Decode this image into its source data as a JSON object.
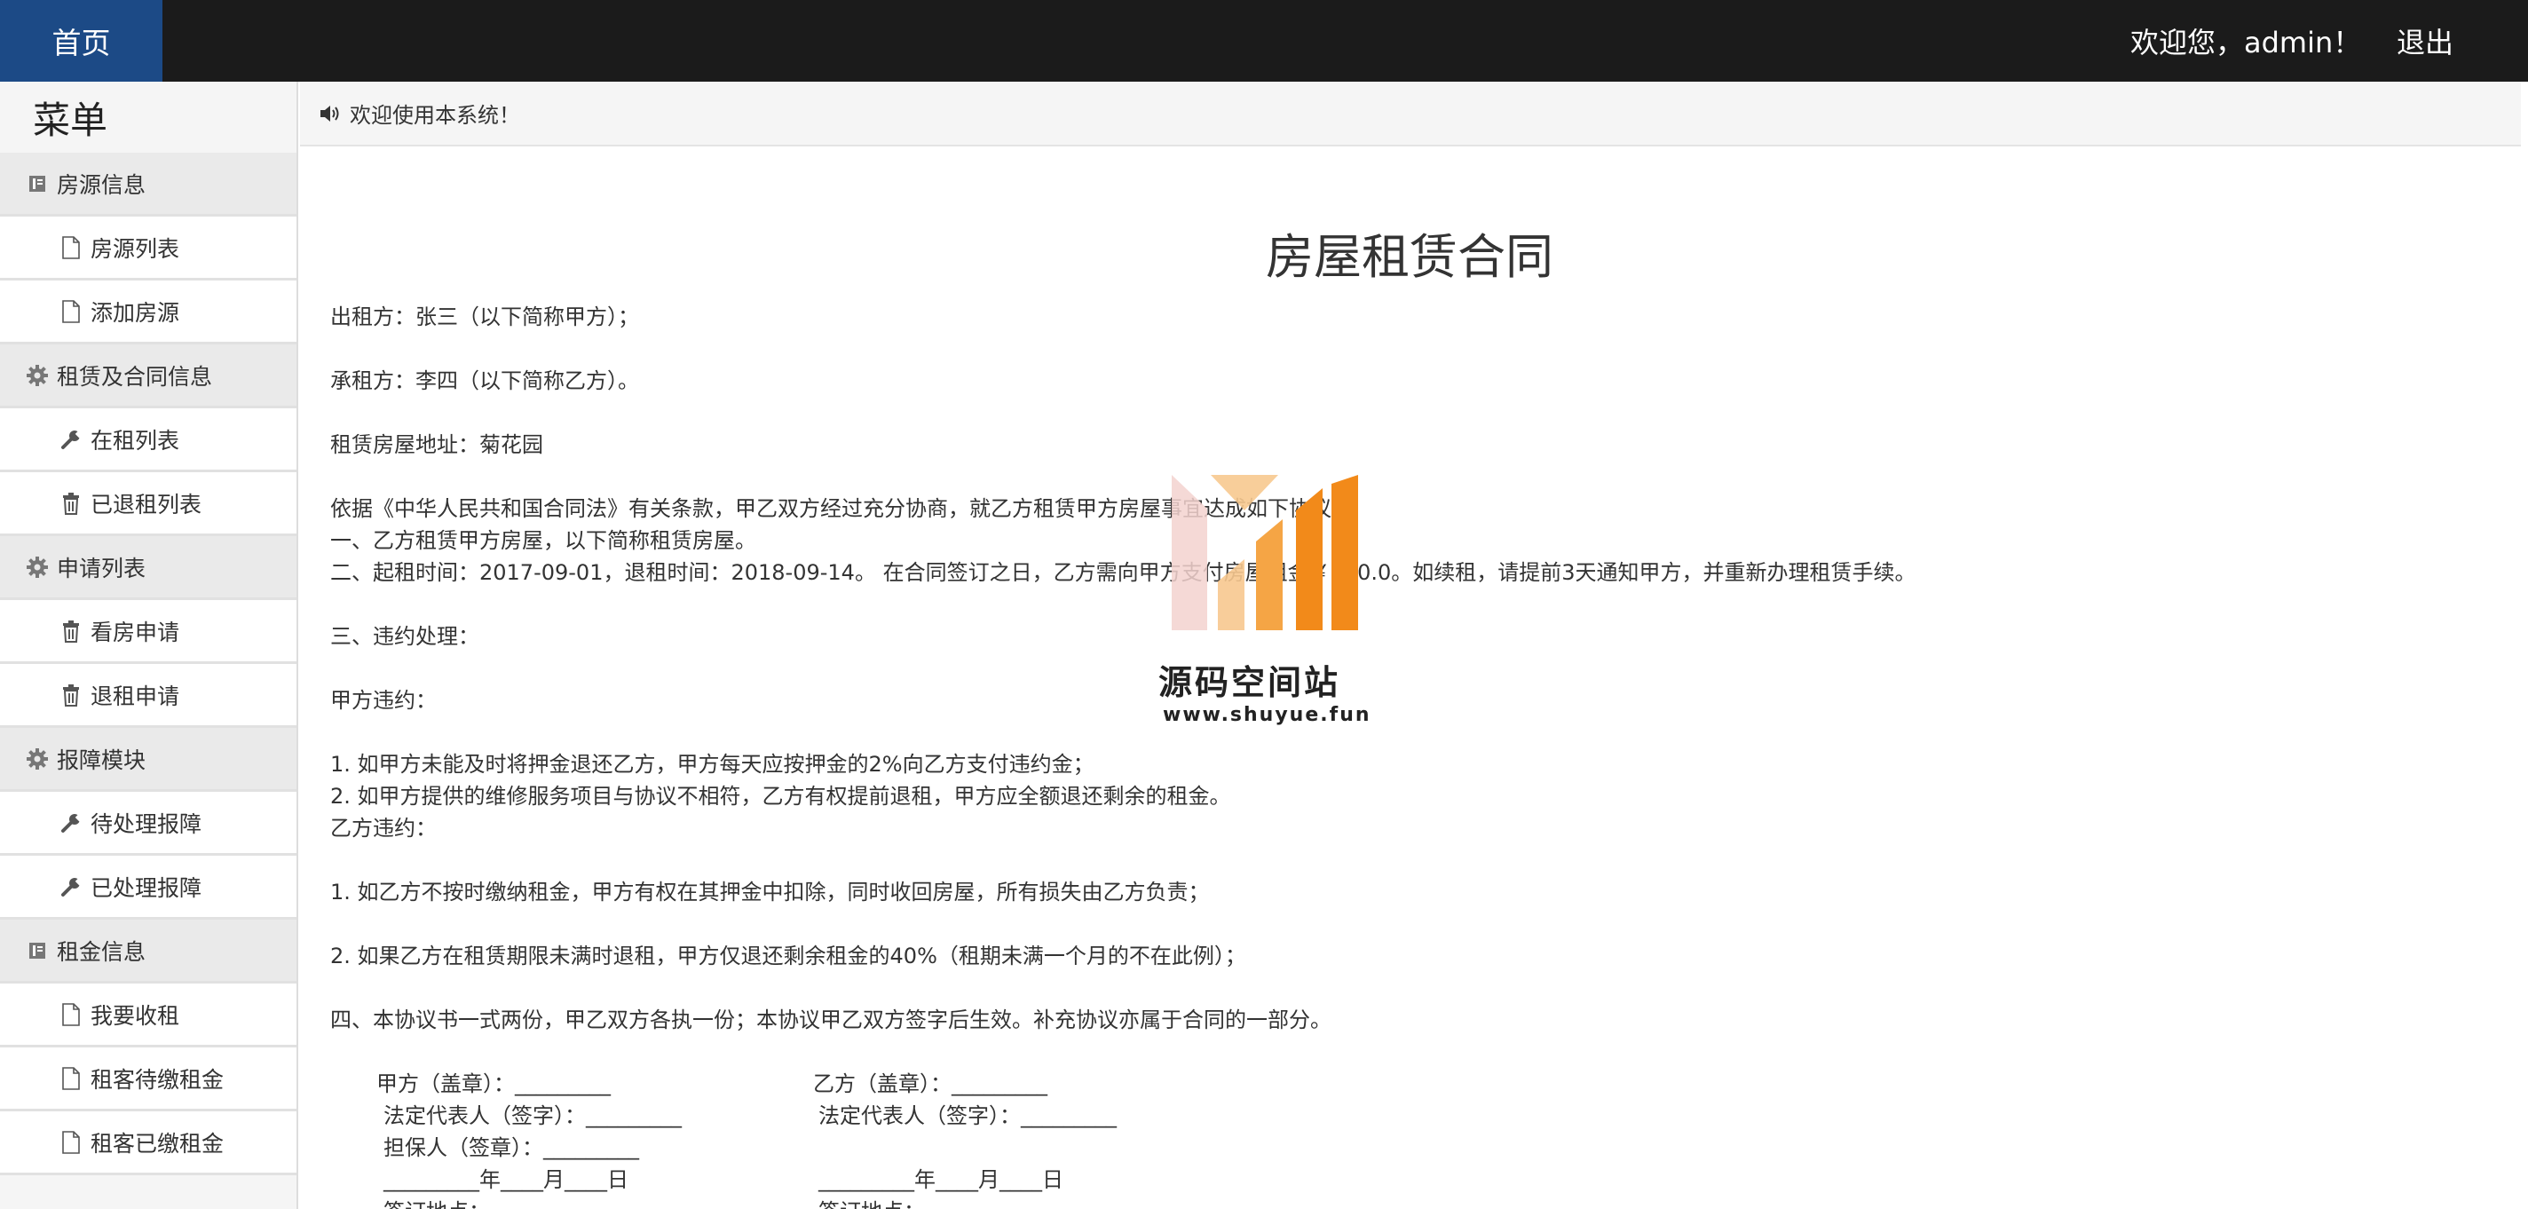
{
  "topbar": {
    "home": "首页",
    "welcome": "欢迎您，admin！",
    "logout": "退出",
    "bg_color": "#1b1b1b",
    "home_color": "#1c4a86"
  },
  "sidebar": {
    "title": "菜单",
    "sections": [
      {
        "label": "房源信息",
        "icon": "book-icon",
        "items": [
          {
            "label": "房源列表",
            "icon": "file-icon"
          },
          {
            "label": "添加房源",
            "icon": "file-icon"
          }
        ]
      },
      {
        "label": "租赁及合同信息",
        "icon": "gear-icon",
        "items": [
          {
            "label": "在租列表",
            "icon": "wrench-icon"
          },
          {
            "label": "已退租列表",
            "icon": "trash-icon"
          }
        ]
      },
      {
        "label": "申请列表",
        "icon": "gear-icon",
        "items": [
          {
            "label": "看房申请",
            "icon": "trash-icon"
          },
          {
            "label": "退租申请",
            "icon": "trash-icon"
          }
        ]
      },
      {
        "label": "报障模块",
        "icon": "gear-icon",
        "items": [
          {
            "label": "待处理报障",
            "icon": "wrench-icon"
          },
          {
            "label": "已处理报障",
            "icon": "wrench-icon"
          }
        ]
      },
      {
        "label": "租金信息",
        "icon": "book-icon",
        "items": [
          {
            "label": "我要收租",
            "icon": "file-icon"
          },
          {
            "label": "租客待缴租金",
            "icon": "file-icon"
          },
          {
            "label": "租客已缴租金",
            "icon": "file-icon"
          }
        ]
      }
    ]
  },
  "notice": {
    "icon": "speaker-icon",
    "text": "欢迎使用本系统！"
  },
  "contract": {
    "title": "房屋租赁合同",
    "lessor": "出租方：张三（以下简称甲方）；",
    "lessee": "承租方：李四（以下简称乙方）。",
    "address": "租赁房屋地址：菊花园",
    "basis": "依据《中华人民共和国合同法》有关条款，甲乙双方经过充分协商，就乙方租赁甲方房屋事宜达成如下协议：",
    "clause1": "一、乙方租赁甲方房屋，以下简称租赁房屋。",
    "clause2": "二、起租时间：2017-09-01，退租时间：2018-09-14。 在合同签订之日，乙方需向甲方支付房屋租金￥900.0。如续租，请提前3天通知甲方，并重新办理租赁手续。",
    "clause3": "三、违约处理：",
    "partyA_breach": "甲方违约：",
    "a1": "1.  如甲方未能及时将押金退还乙方，甲方每天应按押金的2%向乙方支付违约金；",
    "a2": "2.  如甲方提供的维修服务项目与协议不相符，乙方有权提前退租，甲方应全额退还剩余的租金。",
    "partyB_breach": "乙方违约：",
    "b1": "1.  如乙方不按时缴纳租金，甲方有权在其押金中扣除，同时收回房屋，所有损失由乙方负责；",
    "b2": "2.  如果乙方在租赁期限未满时退租，甲方仅退还剩余租金的40%（租期未满一个月的不在此例）；",
    "clause4": "四、本协议书一式两份，甲乙双方各执一份；本协议甲乙双方签字后生效。补充协议亦属于合同的一部分。",
    "signatures": {
      "a_seal": "甲方（盖章）：_________",
      "b_seal": "乙方（盖章）：_________",
      "a_rep": "法定代表人（签字）：_________",
      "b_rep": "法定代表人（签字）：_________",
      "guarantor": "担保人（签章）：_________",
      "a_date": "_________年____月____日",
      "b_date": "_________年____月____日",
      "a_place": "签订地点：",
      "b_place": "签订地点："
    }
  },
  "watermark": {
    "name": "源码空间站",
    "url": "www.shuyue.fun",
    "colors": {
      "orange": "#f28a1a",
      "light_orange": "#f7b774",
      "pink": "#f3d2cf"
    }
  }
}
